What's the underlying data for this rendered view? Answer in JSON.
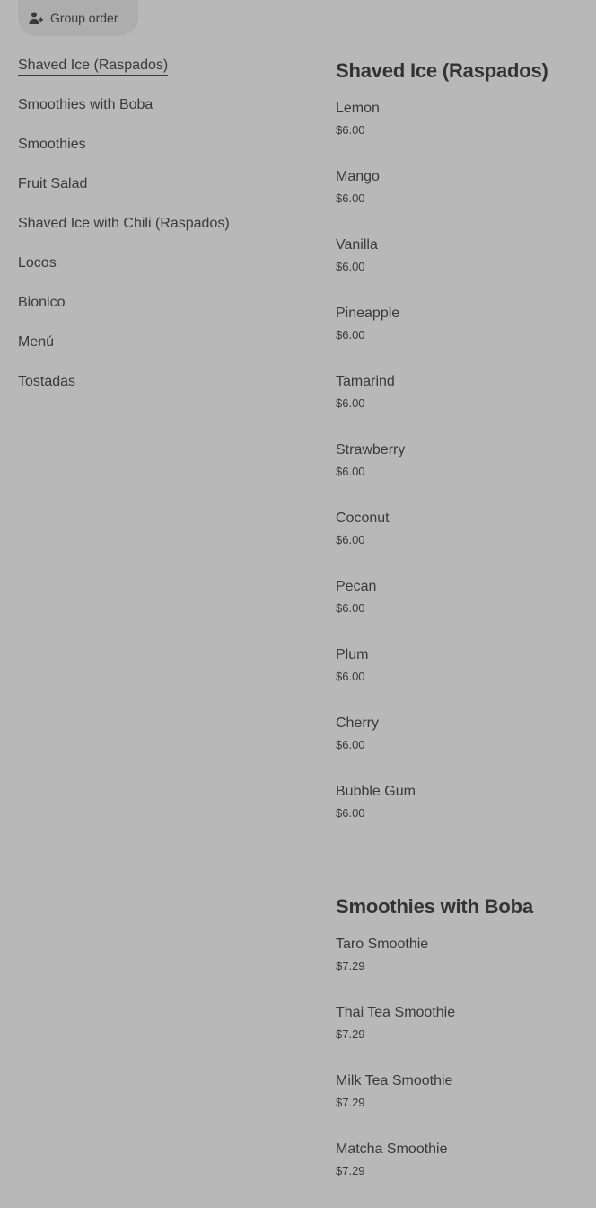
{
  "group_order": {
    "label": "Group order",
    "icon": "add-person-icon"
  },
  "sidebar": {
    "items": [
      {
        "label": "Shaved Ice (Raspados)",
        "active": true
      },
      {
        "label": "Smoothies with Boba"
      },
      {
        "label": "Smoothies"
      },
      {
        "label": "Fruit Salad"
      },
      {
        "label": "Shaved Ice with Chili (Raspados)"
      },
      {
        "label": "Locos"
      },
      {
        "label": "Bionico"
      },
      {
        "label": "Menú"
      },
      {
        "label": "Tostadas"
      }
    ]
  },
  "sections": [
    {
      "title": "Shaved Ice (Raspados)",
      "items": [
        {
          "name": "Lemon",
          "price": "$6.00"
        },
        {
          "name": "Mango",
          "price": "$6.00"
        },
        {
          "name": "Vanilla",
          "price": "$6.00"
        },
        {
          "name": "Pineapple",
          "price": "$6.00"
        },
        {
          "name": "Tamarind",
          "price": "$6.00"
        },
        {
          "name": "Strawberry",
          "price": "$6.00"
        },
        {
          "name": "Coconut",
          "price": "$6.00"
        },
        {
          "name": "Pecan",
          "price": "$6.00"
        },
        {
          "name": "Plum",
          "price": "$6.00"
        },
        {
          "name": "Cherry",
          "price": "$6.00"
        },
        {
          "name": "Bubble Gum",
          "price": "$6.00"
        }
      ]
    },
    {
      "title": "Smoothies with Boba",
      "items": [
        {
          "name": "Taro Smoothie",
          "price": "$7.29"
        },
        {
          "name": "Thai Tea Smoothie",
          "price": "$7.29"
        },
        {
          "name": "Milk Tea Smoothie",
          "price": "$7.29"
        },
        {
          "name": "Matcha Smoothie",
          "price": "$7.29"
        }
      ]
    }
  ]
}
